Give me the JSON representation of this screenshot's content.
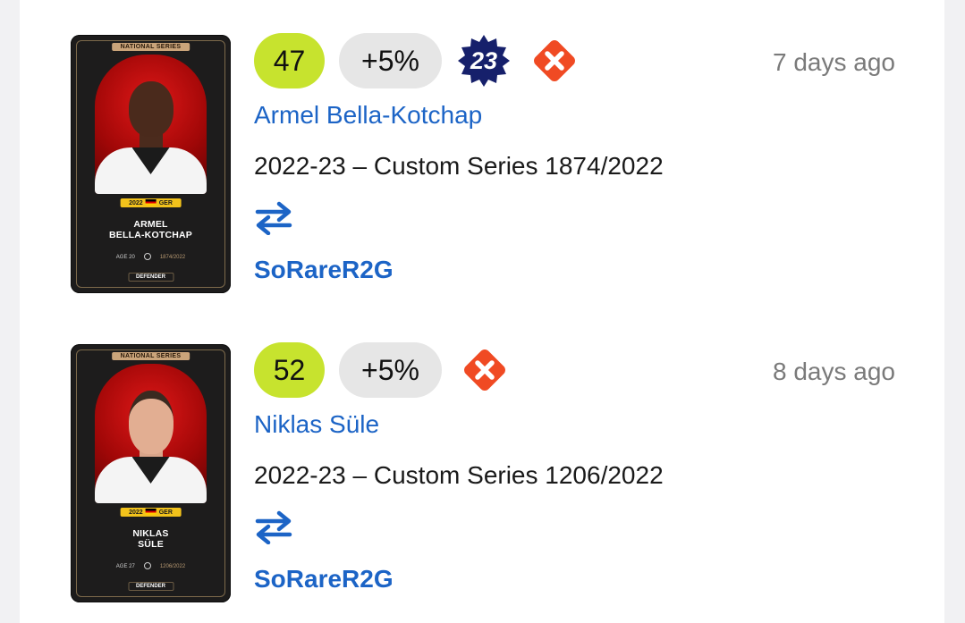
{
  "entries": [
    {
      "score": "47",
      "bonus": "+5%",
      "badge": "23",
      "time_ago": "7 days ago",
      "player_name": "Armel Bella-Kotchap",
      "card_detail": "2022-23 – Custom Series 1874/2022",
      "owner": "SoRareR2G",
      "card": {
        "series_label": "NATIONAL SERIES",
        "season": "2022",
        "country": "GER",
        "name_line1": "ARMEL",
        "name_line2": "BELLA-KOTCHAP",
        "age": "AGE 20",
        "serial": "1874/2022",
        "position": "DEFENDER"
      }
    },
    {
      "score": "52",
      "bonus": "+5%",
      "time_ago": "8 days ago",
      "player_name": "Niklas Süle",
      "card_detail": "2022-23 – Custom Series 1206/2022",
      "owner": "SoRareR2G",
      "card": {
        "series_label": "NATIONAL SERIES",
        "season": "2022",
        "country": "GER",
        "name_line1": "NIKLAS",
        "name_line2": "SÜLE",
        "age": "AGE 27",
        "serial": "1206/2022",
        "position": "DEFENDER"
      }
    }
  ],
  "colors": {
    "score_bg": "#c7e32e",
    "bonus_bg": "#e6e6e6",
    "badge_bg": "#16206b",
    "cross_bg": "#f04a23",
    "link": "#1c64c6",
    "muted": "#7a7a7a"
  },
  "icons": {
    "badge": "starburst-badge-icon",
    "cross": "red-cross-diamond-icon",
    "transfer": "transfer-arrows-icon"
  }
}
